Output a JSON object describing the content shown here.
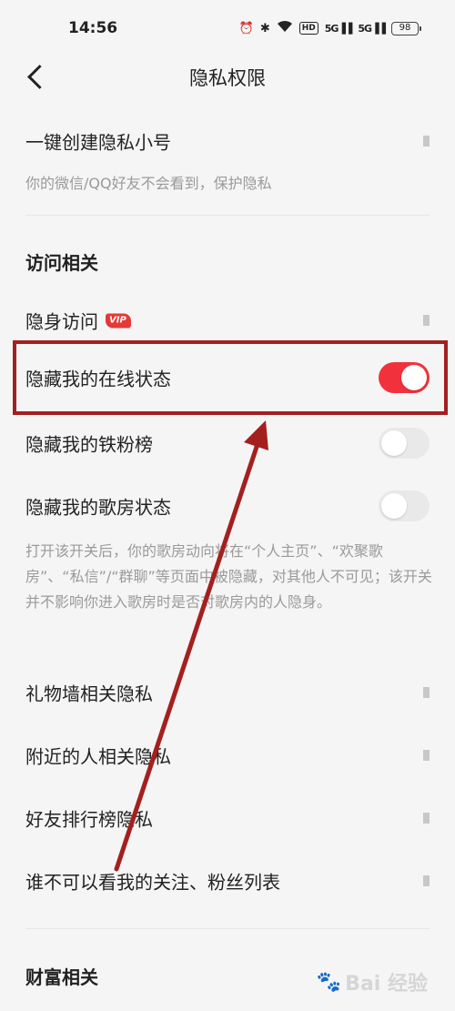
{
  "status_bar": {
    "time": "14:56",
    "alarm_icon": "alarm-icon",
    "bluetooth_icon": "bluetooth-icon",
    "wifi_icon": "wifi-icon",
    "hd_label": "HD",
    "sig1_label": "5G",
    "sig2_label": "5G",
    "battery": "98"
  },
  "header": {
    "title": "隐私权限",
    "back_icon": "chevron-left-icon"
  },
  "settings": {
    "create_alt": {
      "label": "一键创建隐私小号",
      "caption": "你的微信/QQ好友不会看到，保护隐私"
    },
    "section_access": "访问相关",
    "invisible_visit": {
      "label": "隐身访问",
      "badge": "VIP"
    },
    "hide_online": {
      "label": "隐藏我的在线状态",
      "toggle_on": true
    },
    "hide_fans": {
      "label": "隐藏我的铁粉榜",
      "toggle_on": false
    },
    "hide_room": {
      "label": "隐藏我的歌房状态",
      "toggle_on": false
    },
    "room_caption": "打开该开关后，你的歌房动向将在“个人主页”、“欢聚歌房”、“私信”/“群聊”等页面中被隐藏，对其他人不可见；该开关并不影响你进入歌房时是否对歌房内的人隐身。",
    "gift_wall": "礼物墙相关隐私",
    "nearby": "附近的人相关隐私",
    "friend_rank": "好友排行榜隐私",
    "who_cannot_see": "谁不可以看我的关注、粉丝列表",
    "section_wealth": "财富相关"
  },
  "colors": {
    "accent": "#f1323c",
    "annotation": "#a3201f",
    "background": "#f5f5f6"
  },
  "watermark": {
    "text": "Bai  经验",
    "icon": "paw-icon"
  }
}
